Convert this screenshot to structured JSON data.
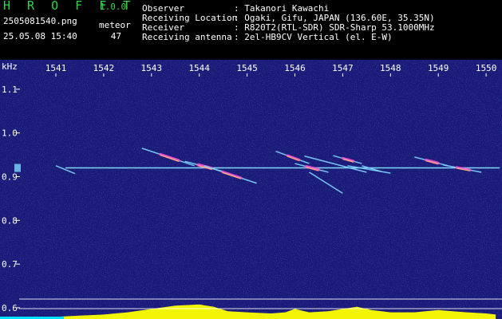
{
  "header": {
    "app_title": "H R O F F T",
    "app_version": "1.0.0",
    "filename": "2505081540.png",
    "meteor_label": "meteor",
    "timestamp": "25.05.08 15:40",
    "meteor_count": "47",
    "info": [
      {
        "label": "Observer",
        "value": ": Takanori Kawachi"
      },
      {
        "label": "Receiving Location",
        "value": ": Ogaki, Gifu, JAPAN (136.60E, 35.35N)"
      },
      {
        "label": "Receiver",
        "value": ": R820T2(RTL-SDR) SDR-Sharp 53.1000MHz"
      },
      {
        "label": "Receiving antenna",
        "value": ": 2el-HB9CV Vertical (el. E-W)"
      }
    ]
  },
  "colors": {
    "background": "#1a1a78",
    "header_bg": "#000000",
    "title_green": "#2fd84a",
    "carrier": "#7fd8ff",
    "echo_hot": "#ff4fd0",
    "echo_warm": "#ffe04a",
    "level_bar": "#ffff00",
    "level_base": "#00e0ff"
  },
  "chart_data": {
    "type": "heatmap",
    "xunit": "",
    "ylabel": "kHz",
    "x_ticks": [
      "1541",
      "1542",
      "1543",
      "1544",
      "1545",
      "1546",
      "1547",
      "1548",
      "1549",
      "1550"
    ],
    "y_ticks": [
      "1.1",
      "1.0",
      "0.9",
      "0.8",
      "0.7",
      "0.6"
    ],
    "ylim": [
      0.578,
      1.16
    ],
    "carrier_khz": 0.92,
    "reference_lines_khz": [
      0.62,
      0.598
    ],
    "echoes": [
      {
        "x0": 1541.0,
        "y0": 0.925,
        "x1": 1541.4,
        "y1": 0.907,
        "strength": 0.4
      },
      {
        "x0": 1542.8,
        "y0": 0.965,
        "x1": 1543.9,
        "y1": 0.925,
        "strength": 0.7
      },
      {
        "x0": 1543.7,
        "y0": 0.935,
        "x1": 1544.5,
        "y1": 0.912,
        "strength": 1.0
      },
      {
        "x0": 1544.1,
        "y0": 0.925,
        "x1": 1545.2,
        "y1": 0.885,
        "strength": 0.6
      },
      {
        "x0": 1545.6,
        "y0": 0.958,
        "x1": 1546.3,
        "y1": 0.93,
        "strength": 0.6
      },
      {
        "x0": 1546.0,
        "y0": 0.93,
        "x1": 1546.7,
        "y1": 0.91,
        "strength": 0.9
      },
      {
        "x0": 1546.3,
        "y0": 0.91,
        "x1": 1547.0,
        "y1": 0.862,
        "strength": 0.4
      },
      {
        "x0": 1546.2,
        "y0": 0.947,
        "x1": 1547.5,
        "y1": 0.91,
        "strength": 0.5
      },
      {
        "x0": 1546.8,
        "y0": 0.948,
        "x1": 1547.4,
        "y1": 0.93,
        "strength": 0.7
      },
      {
        "x0": 1547.1,
        "y0": 0.925,
        "x1": 1548.0,
        "y1": 0.908,
        "strength": 0.5
      },
      {
        "x0": 1547.4,
        "y0": 0.925,
        "x1": 1547.8,
        "y1": 0.912,
        "strength": 0.4
      },
      {
        "x0": 1548.5,
        "y0": 0.945,
        "x1": 1549.2,
        "y1": 0.925,
        "strength": 0.8
      },
      {
        "x0": 1549.1,
        "y0": 0.927,
        "x1": 1549.9,
        "y1": 0.91,
        "strength": 0.6
      }
    ],
    "level_profile": [
      {
        "x": 1541.0,
        "v": 0.1
      },
      {
        "x": 1541.5,
        "v": 0.15
      },
      {
        "x": 1542.0,
        "v": 0.2
      },
      {
        "x": 1542.5,
        "v": 0.3
      },
      {
        "x": 1543.0,
        "v": 0.45
      },
      {
        "x": 1543.5,
        "v": 0.6
      },
      {
        "x": 1544.0,
        "v": 0.65
      },
      {
        "x": 1544.3,
        "v": 0.55
      },
      {
        "x": 1544.6,
        "v": 0.35
      },
      {
        "x": 1545.0,
        "v": 0.3
      },
      {
        "x": 1545.5,
        "v": 0.25
      },
      {
        "x": 1545.8,
        "v": 0.3
      },
      {
        "x": 1546.0,
        "v": 0.45
      },
      {
        "x": 1546.3,
        "v": 0.3
      },
      {
        "x": 1546.7,
        "v": 0.35
      },
      {
        "x": 1547.0,
        "v": 0.45
      },
      {
        "x": 1547.3,
        "v": 0.55
      },
      {
        "x": 1547.6,
        "v": 0.4
      },
      {
        "x": 1548.0,
        "v": 0.3
      },
      {
        "x": 1548.5,
        "v": 0.3
      },
      {
        "x": 1549.0,
        "v": 0.4
      },
      {
        "x": 1549.3,
        "v": 0.35
      },
      {
        "x": 1549.6,
        "v": 0.3
      },
      {
        "x": 1550.0,
        "v": 0.25
      },
      {
        "x": 1550.2,
        "v": 0.2
      }
    ]
  }
}
